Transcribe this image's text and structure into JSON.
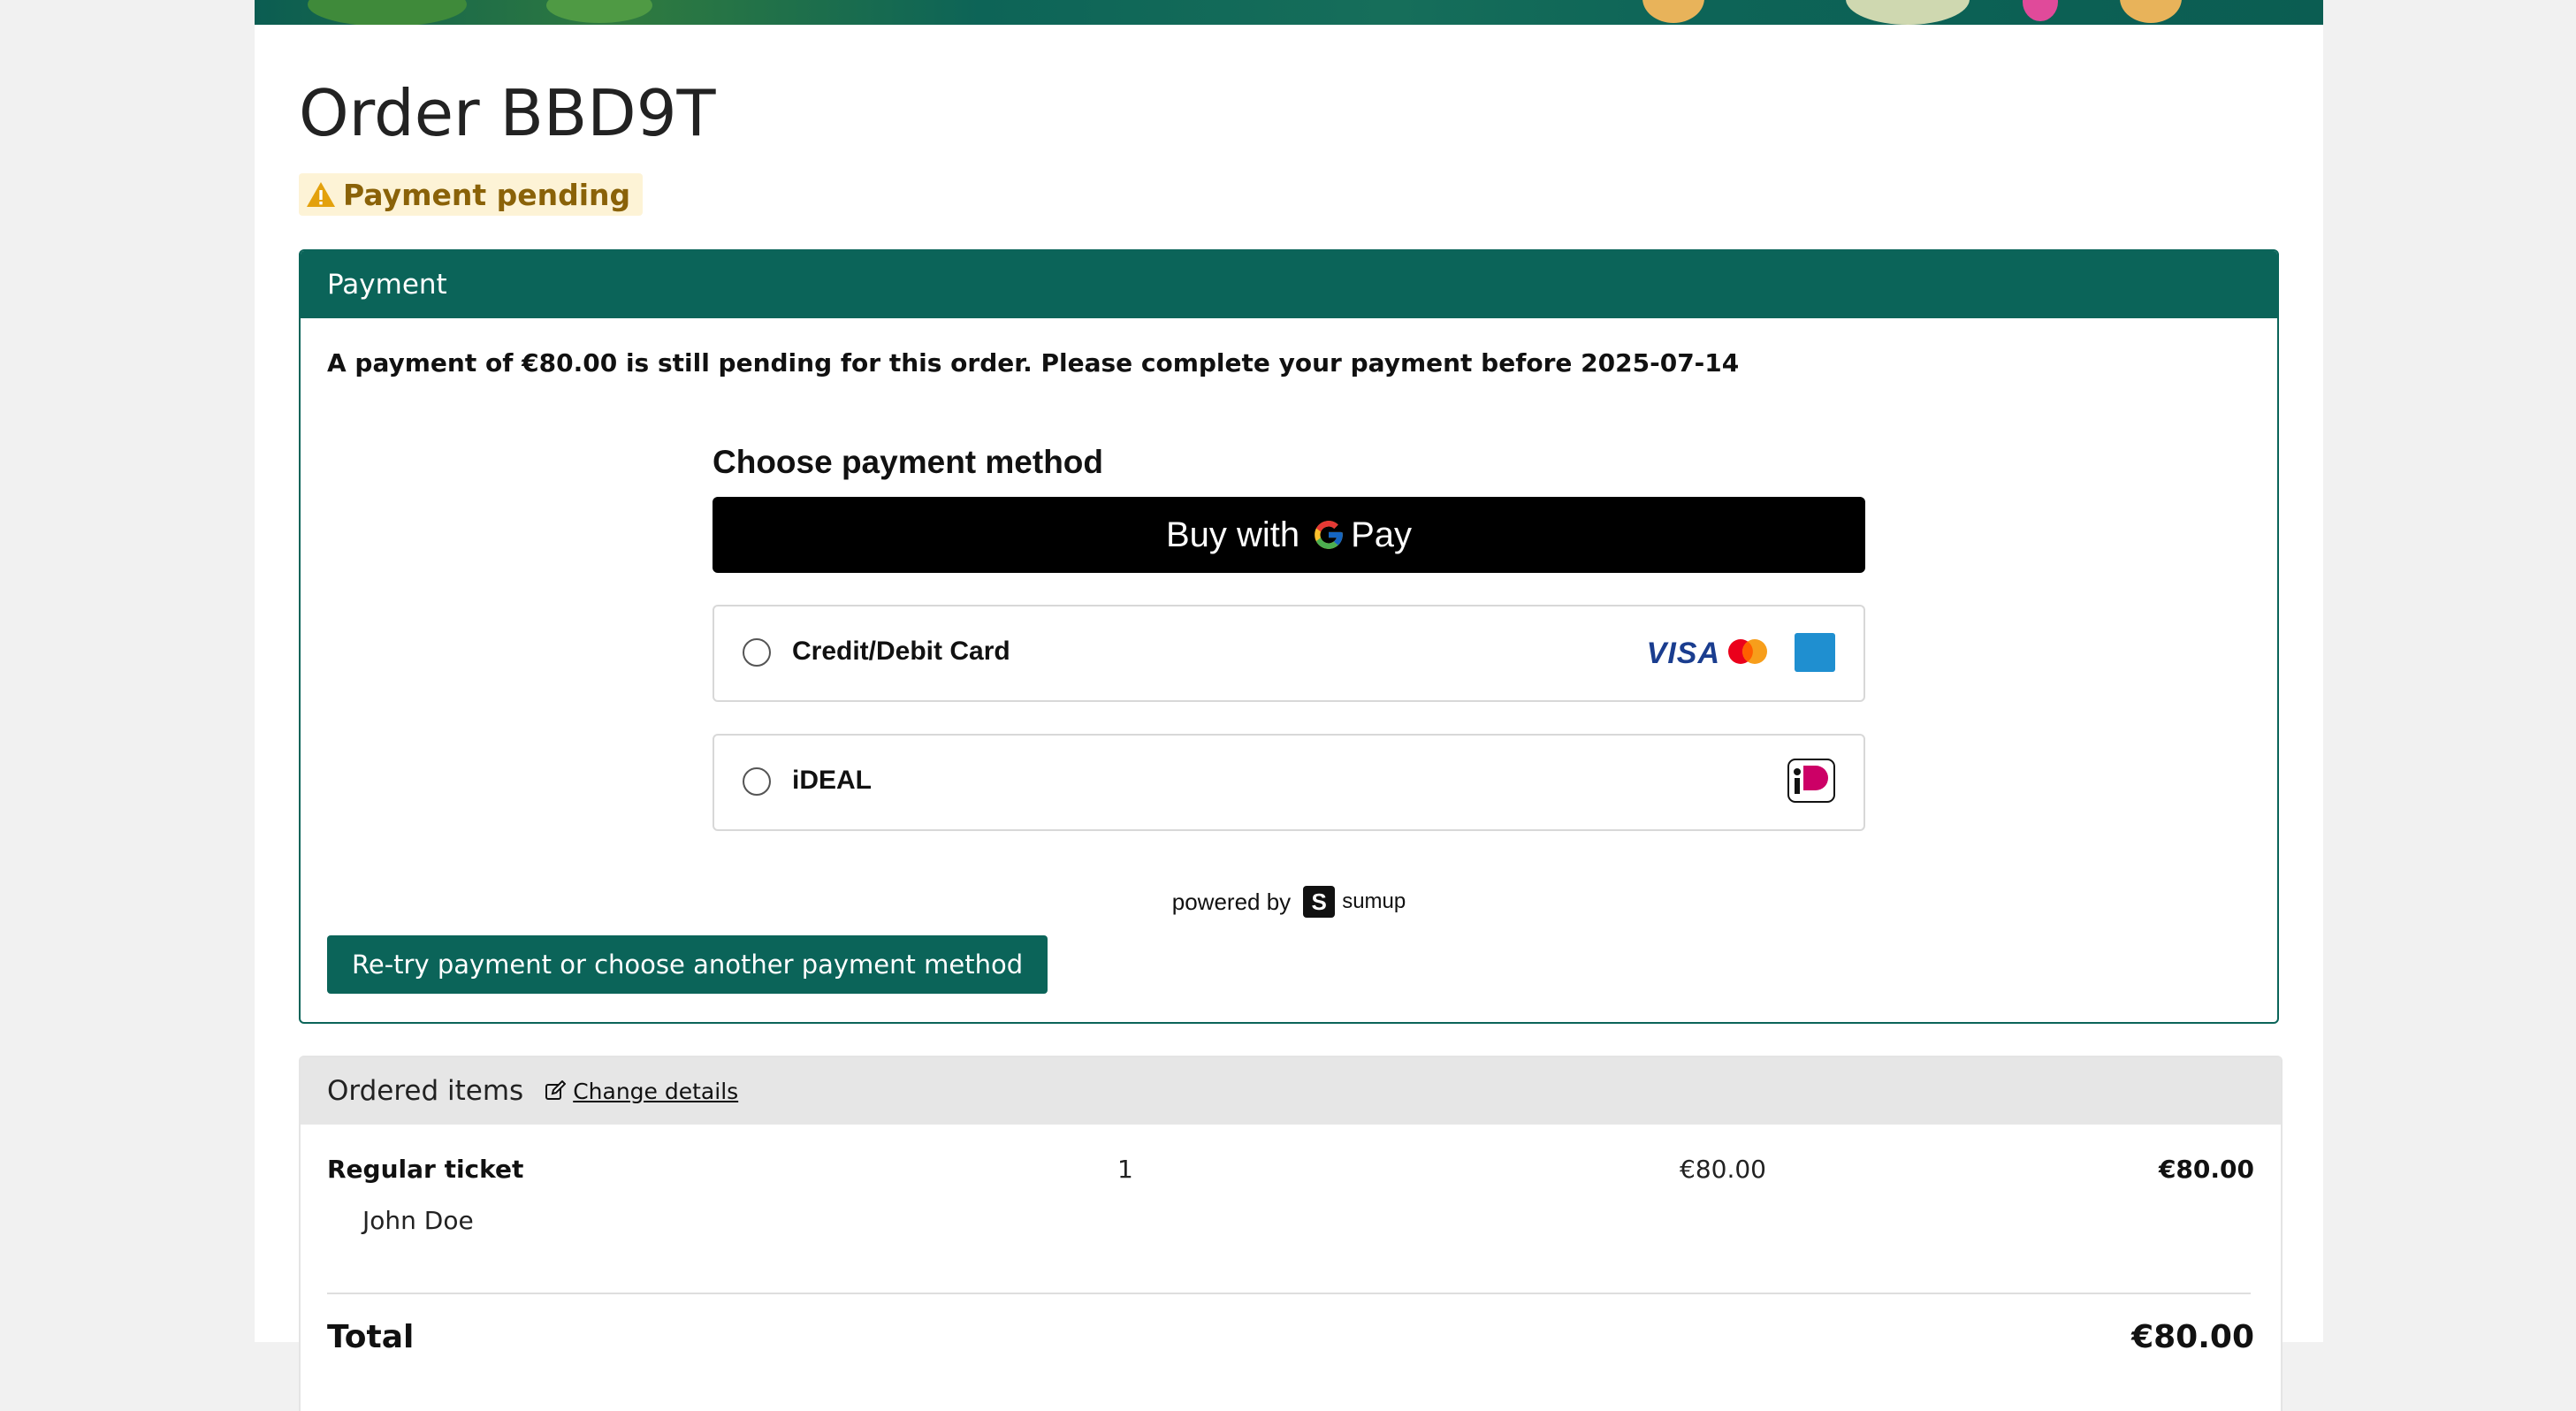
{
  "order": {
    "title": "Order BBD9T",
    "status": "Payment pending"
  },
  "payment": {
    "header": "Payment",
    "pending_message": "A payment of €80.00 is still pending for this order. Please complete your payment before 2025-07-14",
    "widget_title": "Choose payment method",
    "gpay": {
      "prefix": "Buy with",
      "brand": "Pay"
    },
    "methods": [
      {
        "label": "Credit/Debit Card",
        "icons": [
          "visa-logo",
          "mastercard-logo",
          "amex-logo"
        ]
      },
      {
        "label": "iDEAL",
        "icons": [
          "ideal-logo"
        ]
      }
    ],
    "powered_by": "powered by",
    "provider": "sumup",
    "retry_label": "Re-try payment or choose another payment method"
  },
  "items": {
    "header": "Ordered items",
    "change_label": "Change details",
    "rows": [
      {
        "name": "Regular ticket",
        "quantity": "1",
        "price": "€80.00",
        "total": "€80.00",
        "attendee": "John Doe"
      }
    ],
    "total_label": "Total",
    "total_value": "€80.00"
  },
  "brand_colors": {
    "primary": "#0b6459",
    "warning_bg": "#fdf3d6",
    "warning_text": "#8a6208"
  }
}
